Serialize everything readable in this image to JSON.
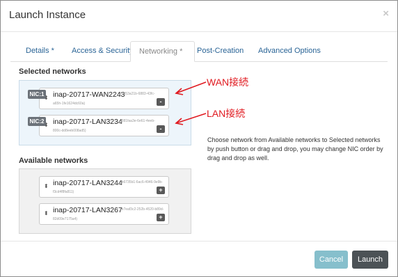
{
  "dialog": {
    "title": "Launch Instance",
    "close_symbol": "×"
  },
  "tabs": [
    {
      "label": "Details *",
      "active": false
    },
    {
      "label": "Access & Security",
      "active": false
    },
    {
      "label": "Networking *",
      "active": true
    },
    {
      "label": "Post-Creation",
      "active": false
    },
    {
      "label": "Advanced Options",
      "active": false
    }
  ],
  "selected": {
    "heading": "Selected networks",
    "items": [
      {
        "nic": "NIC:1",
        "name": "inap-20717-WAN2243",
        "uuid_a": "(5d53a21b-6883-43fc-",
        "uuid_b": "a65h-1fe1624dc60a)",
        "action": "-"
      },
      {
        "nic": "NIC:2",
        "name": "inap-20717-LAN3234",
        "uuid_a": "(381faa3e-6e61-4eeb-",
        "uuid_b": "800c-dd8eeb008ad5)",
        "action": "-"
      }
    ]
  },
  "available": {
    "heading": "Available networks",
    "items": [
      {
        "name": "inap-20717-LAN3244",
        "uuid_a": "(b6735b1-6ac6-4946-9e9b-",
        "uuid_b": "f3cd4f8fa811)",
        "action": "+"
      },
      {
        "name": "inap-20717-LAN3267",
        "uuid_a": "(e7eaf3c2-252b-4520-b89d-",
        "uuid_b": "82d09e7175a4)",
        "action": "+"
      }
    ]
  },
  "annotations": {
    "wan": "WAN接続",
    "lan": "LAN接続",
    "color": "#e0191f"
  },
  "help_text": "Choose network from Available networks to Selected networks by push button or drag and drop, you may change NIC order by drag and drop as well.",
  "footer": {
    "cancel_label": "Cancel",
    "launch_label": "Launch"
  },
  "colors": {
    "link": "#2a6496",
    "selected_panel": "#edf5fb",
    "available_panel": "#f1f1f1",
    "cancel": "#86bfcc",
    "launch": "#4c5256",
    "nic_badge": "#6c7279"
  },
  "icons": {
    "sort": "sort-arrows-icon",
    "remove": "minus-icon",
    "add": "plus-icon",
    "close": "close-icon"
  }
}
